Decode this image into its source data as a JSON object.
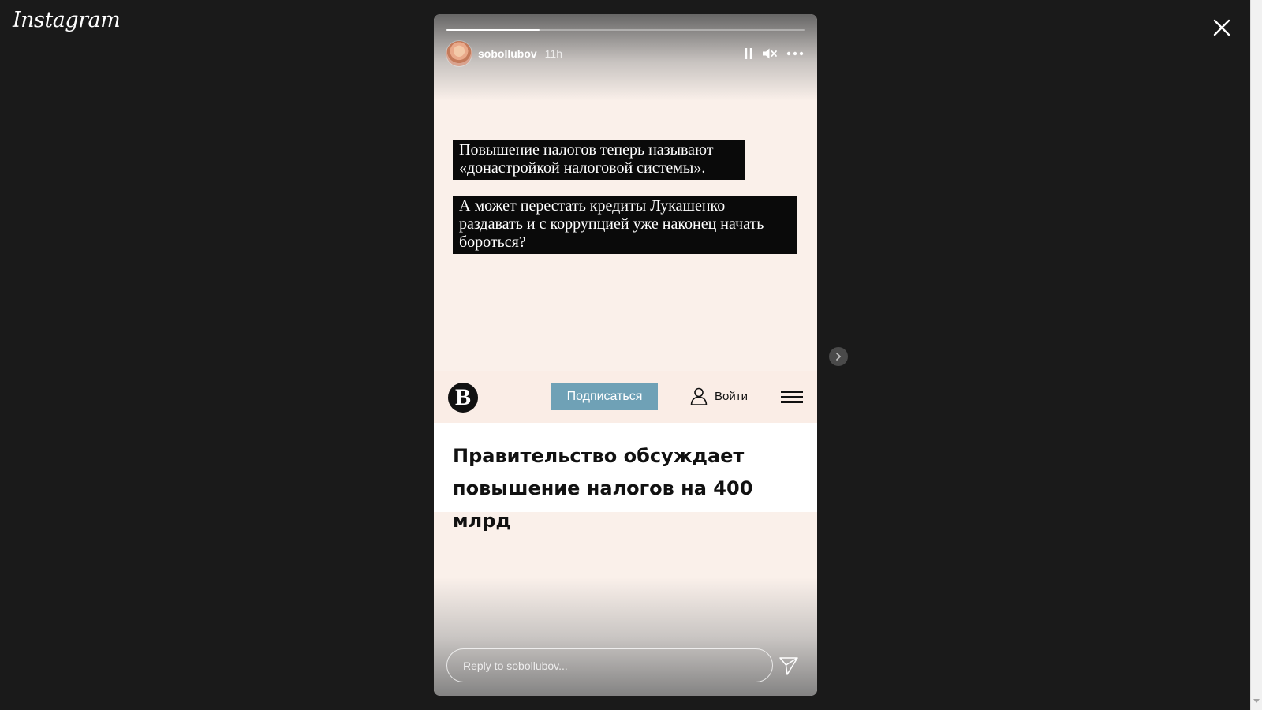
{
  "app": {
    "logo": "Instagram"
  },
  "story": {
    "progress": [
      1.0,
      0.0
    ],
    "username": "sobollubov",
    "time": "11h",
    "controls": {
      "pause": "pause-icon",
      "mute": "muted-speaker-icon",
      "more": "more-icon"
    },
    "caption1": "Повышение налогов теперь называют «донастройкой налоговой системы».",
    "caption2": "А может перестать кредиты Лукашенко раздавать и с коррупцией уже наконец начать бороться?",
    "site": {
      "logo_letter": "В",
      "subscribe": "Подписаться",
      "login": "Войти",
      "headline": "Правительство обсуждает повышение налогов на 400 млрд"
    },
    "reply_placeholder": "Reply to sobollubov..."
  }
}
